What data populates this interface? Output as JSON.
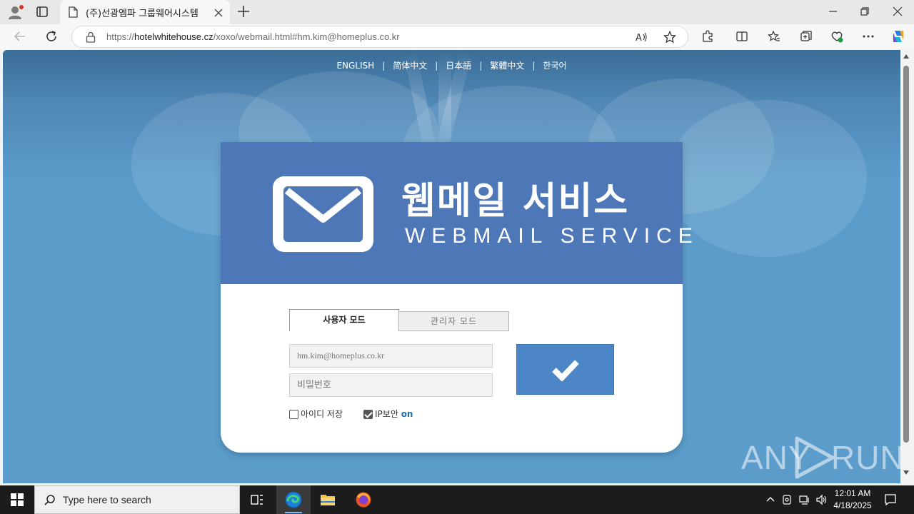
{
  "browser": {
    "tab_title": "(주)선광엠파 그룹웨어시스템",
    "url_scheme": "https://",
    "url_host": "hotelwhitehouse.cz",
    "url_path": "/xoxo/webmail.html#hm.kim@homeplus.co.kr"
  },
  "page": {
    "languages": [
      "ENGLISH",
      "简体中文",
      "日本語",
      "繁體中文",
      "한국어"
    ],
    "title_ko": "웹메일 서비스",
    "title_en": "WEBMAIL SERVICE",
    "tab_user": "사용자 모드",
    "tab_admin": "관리자 모드",
    "id_value": "hm.kim@homeplus.co.kr",
    "pw_placeholder": "비밀번호",
    "save_id_label": "아이디 저장",
    "ip_security_label": "IP보안",
    "ip_security_state": "on",
    "save_id_checked": false,
    "ip_security_checked": true
  },
  "watermark": {
    "left": "ANY",
    "right": "RUN"
  },
  "taskbar": {
    "search_placeholder": "Type here to search",
    "time": "12:01 AM",
    "date": "4/18/2025"
  },
  "colors": {
    "header_blue": "#4e77b8",
    "login_button": "#4d86c6",
    "ip_on": "#1a6fb5"
  }
}
